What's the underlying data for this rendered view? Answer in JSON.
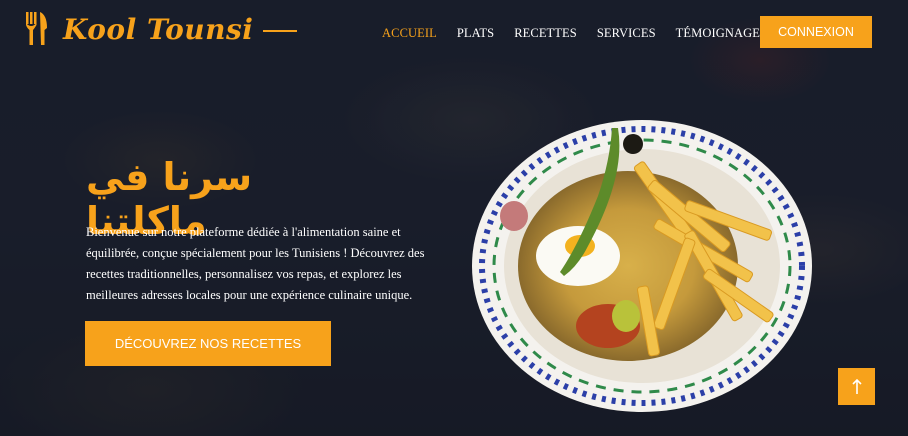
{
  "brand": {
    "name": "Kool Tounsi",
    "icon": "fork-knife-icon",
    "color": "#f7a21b"
  },
  "nav": {
    "items": [
      {
        "label": "ACCUEIL",
        "active": true
      },
      {
        "label": "PLATS",
        "active": false
      },
      {
        "label": "RECETTES",
        "active": false
      },
      {
        "label": "SERVICES",
        "active": false
      },
      {
        "label": "TÉMOIGNAGES",
        "active": false
      }
    ],
    "login_label": "CONNEXION"
  },
  "hero": {
    "title": "سرنا في ماكلتنا",
    "description": "Bienvenue sur notre plateforme dédiée à l'alimentation saine et équilibrée, conçue spécialement pour les Tunisiens ! Découvrez des recettes traditionnelles, personnalisez vos repas, et explorez les meilleures adresses locales pour une expérience culinaire unique.",
    "cta_label": "DÉCOUVREZ NOS RECETTES"
  },
  "scroll_top": {
    "icon": "arrow-up-icon"
  },
  "colors": {
    "accent": "#f7a21b",
    "background": "#1d2130"
  }
}
